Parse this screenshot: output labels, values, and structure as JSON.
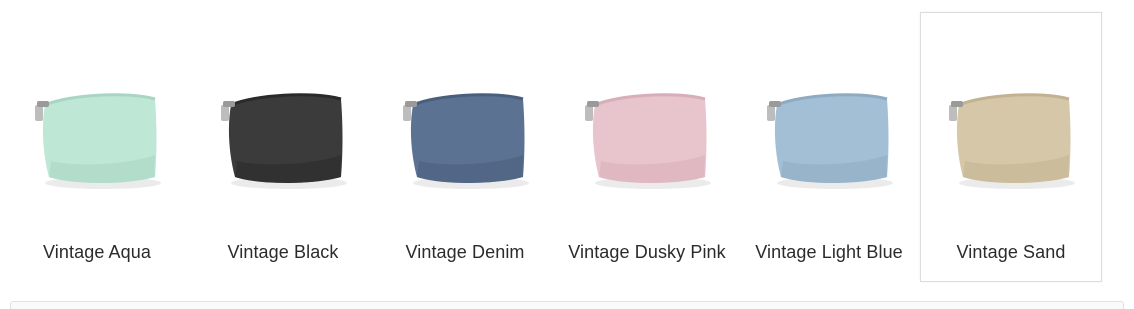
{
  "swatches": [
    {
      "label": "Vintage Aqua",
      "color": "#bfe7d6",
      "shade": "#a8d6c3",
      "selected": false
    },
    {
      "label": "Vintage Black",
      "color": "#3b3b3b",
      "shade": "#2a2a2a",
      "selected": false
    },
    {
      "label": "Vintage Denim",
      "color": "#5b7292",
      "shade": "#4a5f7c",
      "selected": false
    },
    {
      "label": "Vintage Dusky Pink",
      "color": "#e8c4cc",
      "shade": "#d8aeb8",
      "selected": false
    },
    {
      "label": "Vintage Light Blue",
      "color": "#a3bfd6",
      "shade": "#8eabc3",
      "selected": false
    },
    {
      "label": "Vintage Sand",
      "color": "#d6c7a8",
      "shade": "#c2b291",
      "selected": true
    }
  ]
}
